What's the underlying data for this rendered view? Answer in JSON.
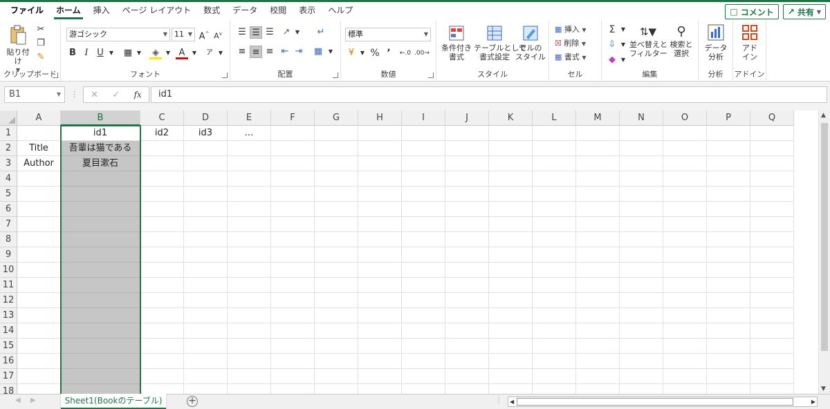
{
  "tabs": [
    "ファイル",
    "ホーム",
    "挿入",
    "ページ レイアウト",
    "数式",
    "データ",
    "校閲",
    "表示",
    "ヘルプ"
  ],
  "active_tab": "ホーム",
  "top_actions": {
    "comment": "コメント",
    "share": "共有"
  },
  "ribbon": {
    "clipboard": {
      "paste": "貼り付け",
      "label": "クリップボード"
    },
    "font": {
      "name": "游ゴシック",
      "size": "11",
      "label": "フォント",
      "bold": "B",
      "italic": "I",
      "underline": "U"
    },
    "alignment": {
      "label": "配置"
    },
    "number": {
      "format": "標準",
      "label": "数値"
    },
    "styles": {
      "conditional": "条件付き\n書式",
      "table": "テーブルとして\n書式設定",
      "cell": "セルの\nスタイル",
      "label": "スタイル"
    },
    "cells": {
      "insert": "挿入",
      "delete": "削除",
      "format": "書式",
      "label": "セル"
    },
    "editing": {
      "sort": "並べ替えと\nフィルター",
      "find": "検索と\n選択",
      "label": "編集"
    },
    "analysis": {
      "data": "データ\n分析",
      "label": "分析"
    },
    "addins": {
      "addin": "アド\nイン",
      "label": "アドイン"
    }
  },
  "formula_bar": {
    "name_box": "B1",
    "fx": "fx",
    "value": "id1"
  },
  "columns": [
    "A",
    "B",
    "C",
    "D",
    "E",
    "F",
    "G",
    "H",
    "I",
    "J",
    "K",
    "L",
    "M",
    "N",
    "O",
    "P",
    "Q"
  ],
  "rows": [
    "1",
    "2",
    "3",
    "4",
    "5",
    "6",
    "7",
    "8",
    "9",
    "10",
    "11",
    "12",
    "13",
    "14",
    "15",
    "16",
    "17",
    "18"
  ],
  "cells": [
    {
      "ref": "B1",
      "value": "id1"
    },
    {
      "ref": "C1",
      "value": "id2"
    },
    {
      "ref": "D1",
      "value": "id3"
    },
    {
      "ref": "E1",
      "value": "…"
    },
    {
      "ref": "A2",
      "value": "Title"
    },
    {
      "ref": "B2",
      "value": "吾輩は猫である"
    },
    {
      "ref": "A3",
      "value": "Author"
    },
    {
      "ref": "B3",
      "value": "夏目漱石"
    }
  ],
  "selected_column": "B",
  "active_cell": "B1",
  "sheet_tab": "Sheet1(Bookのテーブル)",
  "colors": {
    "accent": "#217346",
    "selection": "#c6c6c6"
  }
}
